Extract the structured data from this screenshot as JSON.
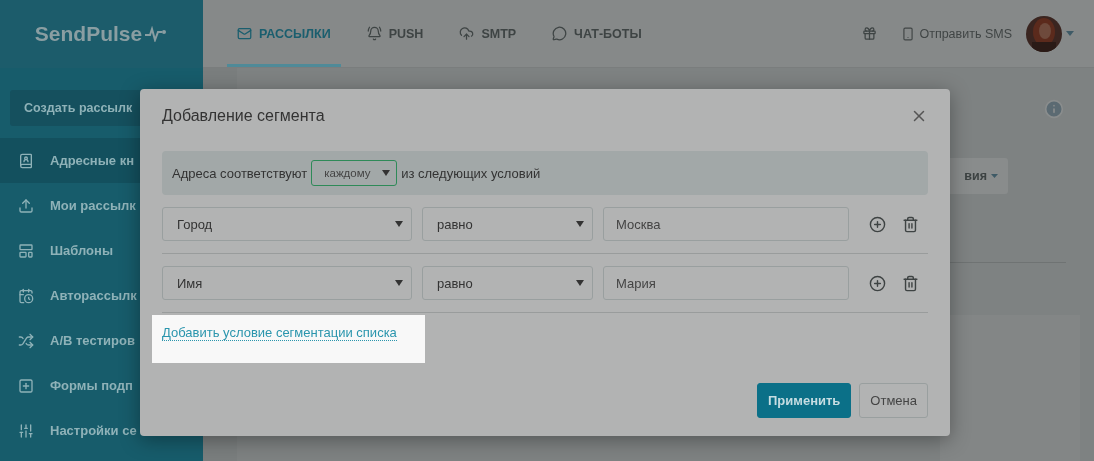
{
  "header": {
    "logo": "SendPulse",
    "tabs": [
      {
        "label": "РАССЫЛКИ",
        "selected": true
      },
      {
        "label": "PUSH",
        "selected": false
      },
      {
        "label": "SMTP",
        "selected": false
      },
      {
        "label": "ЧАТ-БОТЫ",
        "selected": false
      }
    ],
    "sms_link": "Отправить SMS"
  },
  "sidebar": {
    "create_button": "Создать рассылк",
    "items": [
      {
        "label": "Адресные кн",
        "selected": true
      },
      {
        "label": "Мои рассылк",
        "selected": false
      },
      {
        "label": "Шаблоны",
        "selected": false
      },
      {
        "label": "Авторассылк",
        "selected": false
      },
      {
        "label": "A/B тестиров",
        "selected": false
      },
      {
        "label": "Формы подп",
        "selected": false
      },
      {
        "label": "Настройки се",
        "selected": false
      }
    ]
  },
  "background": {
    "dropdown": "вия"
  },
  "dialog": {
    "title": "Добавление сегмента",
    "match": {
      "prefix": "Адреса соответствуют",
      "value": "каждому",
      "suffix": "из следующих условий"
    },
    "conditions": [
      {
        "field": "Город",
        "operator": "равно",
        "value": "Москва"
      },
      {
        "field": "Имя",
        "operator": "равно",
        "value": "Мария"
      }
    ],
    "add_link": "Добавить условие сегментации списка",
    "buttons": [
      {
        "label": "Применить",
        "kind": "primary"
      },
      {
        "label": "Отмена",
        "kind": "secondary"
      }
    ]
  }
}
